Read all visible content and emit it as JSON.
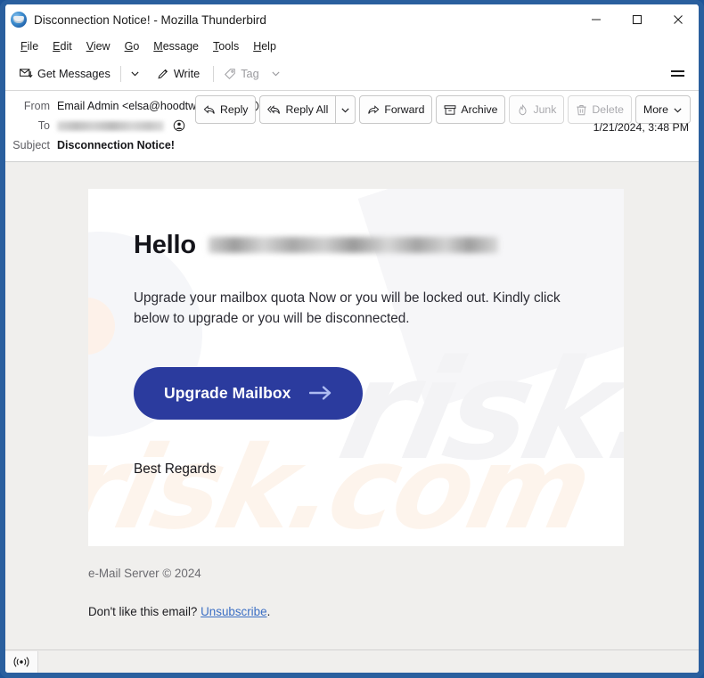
{
  "window": {
    "title": "Disconnection Notice! - Mozilla Thunderbird",
    "logo_icon": "thunderbird-logo",
    "controls": {
      "minimize": "minimize-icon",
      "maximize": "maximize-icon",
      "close": "close-icon"
    }
  },
  "menubar": {
    "items": [
      {
        "label": "File"
      },
      {
        "label": "Edit"
      },
      {
        "label": "View"
      },
      {
        "label": "Go"
      },
      {
        "label": "Message"
      },
      {
        "label": "Tools"
      },
      {
        "label": "Help"
      }
    ]
  },
  "toolbar": {
    "get_messages_label": "Get Messages",
    "get_messages_icon": "envelope-download-icon",
    "get_messages_chevron": "chevron-down-icon",
    "write_label": "Write",
    "write_icon": "pencil-icon",
    "tag_label": "Tag",
    "tag_icon": "tag-icon",
    "tag_chevron": "chevron-down-icon",
    "app_menu_icon": "hamburger-icon"
  },
  "message_header": {
    "from_label": "From",
    "from_value": "Email Admin <elsa@hoodtwink.com>",
    "from_avatar_icon": "contact-avatar-icon",
    "to_label": "To",
    "to_value": "",
    "to_redacted": true,
    "to_avatar_icon": "contact-avatar-icon",
    "subject_label": "Subject",
    "subject_value": "Disconnection Notice!",
    "date": "1/21/2024, 3:48 PM",
    "actions": [
      {
        "label": "Reply",
        "icon": "reply-icon",
        "disabled": false
      },
      {
        "label": "Reply All",
        "icon": "reply-all-icon",
        "disabled": false
      },
      {
        "label": "Forward",
        "icon": "forward-icon",
        "disabled": false
      },
      {
        "label": "Archive",
        "icon": "archive-box-icon",
        "disabled": false
      },
      {
        "label": "Junk",
        "icon": "junk-fire-icon",
        "disabled": true
      },
      {
        "label": "Delete",
        "icon": "trash-icon",
        "disabled": true
      },
      {
        "label": "More",
        "icon": "chevron-down-icon",
        "disabled": false
      }
    ],
    "reply_all_chevron": "chevron-down-icon"
  },
  "email": {
    "greeting": "Hello",
    "greeting_recipient_redacted": true,
    "body": "Upgrade your mailbox quota Now or you will be locked out. Kindly click below to upgrade or you will be disconnected.",
    "cta_label": "Upgrade Mailbox",
    "cta_arrow_icon": "arrow-right-icon",
    "cta_color": "#2b3b9e",
    "signoff": "Best Regards",
    "watermark_text": "risk.com",
    "footer_copyright": "e-Mail Server © 2024",
    "footer_prompt": "Don't like this email?",
    "footer_unsubscribe": "Unsubscribe",
    "footer_period": ".",
    "footer_link_color": "#3c6fc4"
  },
  "statusbar": {
    "online_icon": "online-broadcast-icon",
    "online_glyph": "((●))"
  }
}
